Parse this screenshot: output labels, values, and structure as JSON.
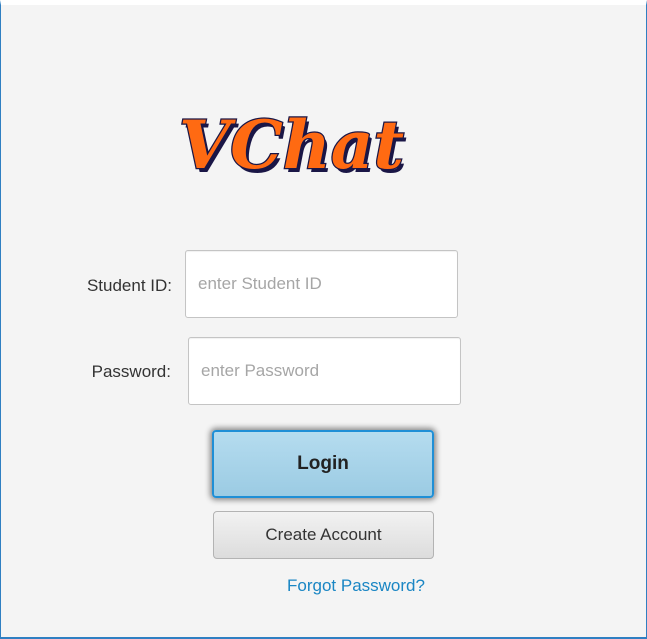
{
  "app": {
    "logo_text": "VChat",
    "logo_color": "#ff6a12",
    "logo_outline_color": "#1a1646"
  },
  "form": {
    "student_id_label": "Student ID:",
    "student_id_placeholder": "enter Student ID",
    "student_id_value": "",
    "password_label": "Password:",
    "password_placeholder": "enter Password",
    "password_value": ""
  },
  "actions": {
    "login_label": "Login",
    "create_account_label": "Create Account",
    "forgot_password_label": "Forgot Password?"
  },
  "colors": {
    "accent": "#1f8fd6",
    "link": "#1a86c4",
    "background": "#f4f4f4"
  }
}
